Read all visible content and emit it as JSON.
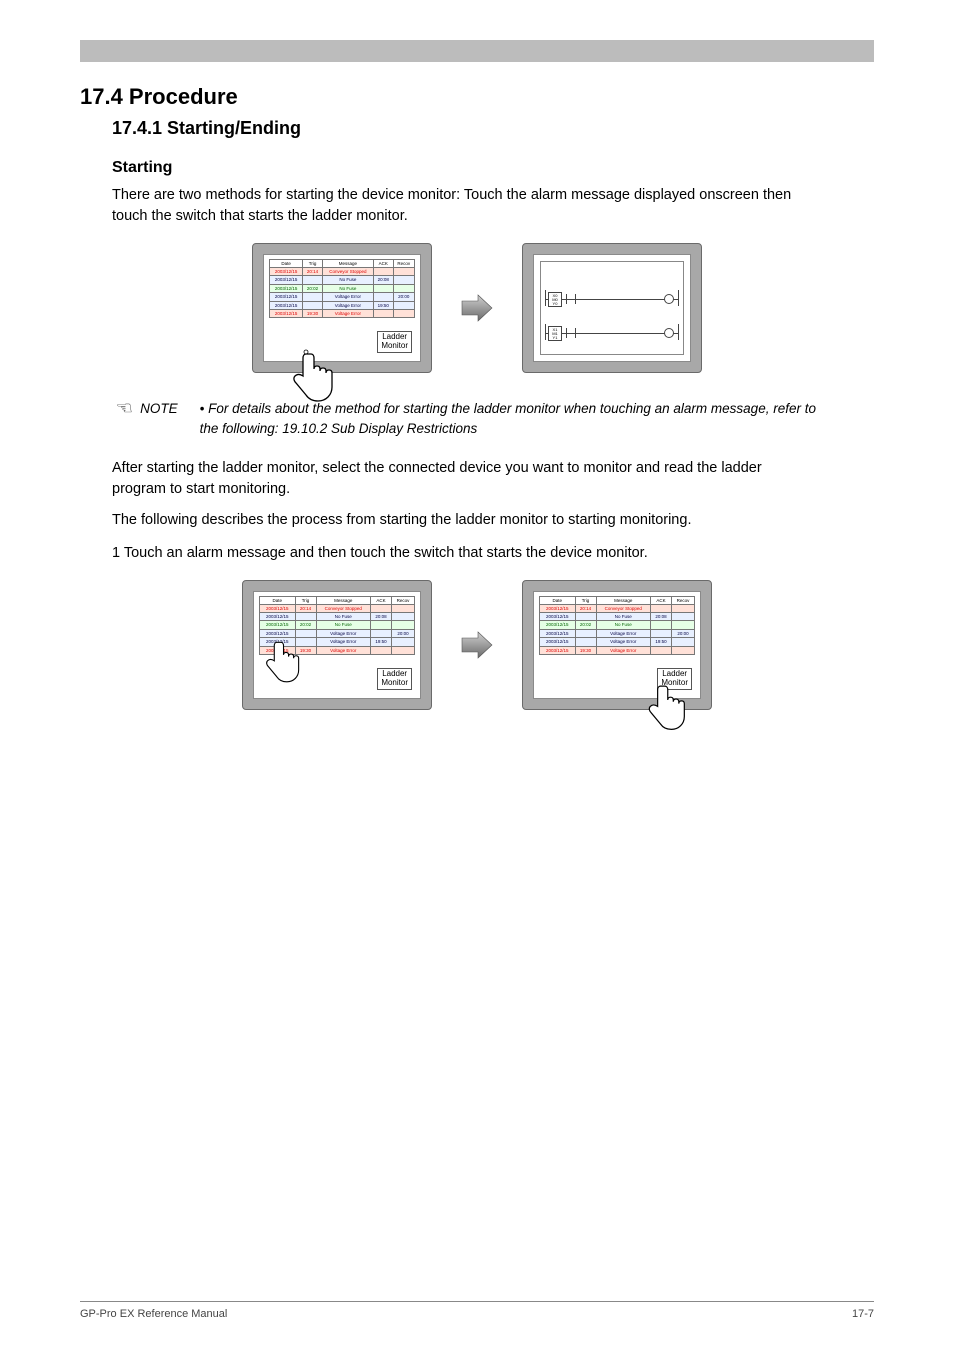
{
  "section": {
    "number": "17.4        Procedure",
    "subtitle": "17.4.1    Starting/Ending"
  },
  "intro_label": "Starting",
  "para1": "There are two methods for starting the device monitor: Touch the alarm message displayed onscreen then touch the switch that starts the ladder monitor.",
  "note_text": "For details about the method for starting the ladder monitor when touching an alarm message, refer to the following:  19.10.2 Sub Display Restrictions",
  "para2": "After starting the ladder monitor, select the connected device you want to monitor and read the ladder program to start monitoring.",
  "para3": "The following describes the process from starting the ladder monitor to starting monitoring.",
  "step1": "1  Touch an alarm message and then touch the switch that starts the device monitor.",
  "labels": {
    "ladder": "Ladder",
    "monitor": "Monitor"
  },
  "alarm_headers": [
    "Date",
    "Trig",
    "Message",
    "ACK",
    "Recov"
  ],
  "alarm_rows_screen1": [
    {
      "cls": "row-high",
      "date": "2003/12/15",
      "trig": "20:14",
      "msg": "Conveyor Stopped",
      "ack": "",
      "rec": ""
    },
    {
      "cls": "row-med",
      "date": "2003/12/15",
      "trig": "",
      "msg": "No Fuse",
      "ack": "20:08",
      "rec": ""
    },
    {
      "cls": "row-low",
      "date": "2003/12/15",
      "trig": "20:02",
      "msg": "No Fuse",
      "ack": "",
      "rec": ""
    },
    {
      "cls": "row-med",
      "date": "2003/12/15",
      "trig": "",
      "msg": "Voltage Error",
      "ack": "",
      "rec": "20:00"
    },
    {
      "cls": "row-med",
      "date": "2003/12/15",
      "trig": "",
      "msg": "Voltage Error",
      "ack": "19:50",
      "rec": ""
    },
    {
      "cls": "row-high",
      "date": "2003/12/15",
      "trig": "19:30",
      "msg": "Voltage Error",
      "ack": "",
      "rec": ""
    }
  ],
  "alarm_rows_screenA": [
    {
      "cls": "row-high",
      "date": "2003/12/15",
      "trig": "20:14",
      "msg": "Conveyor Stopped",
      "ack": "",
      "rec": ""
    },
    {
      "cls": "row-med",
      "date": "2003/12/15",
      "trig": "",
      "msg": "No Fuse",
      "ack": "20:08",
      "rec": ""
    },
    {
      "cls": "row-low",
      "date": "2003/12/15",
      "trig": "20:02",
      "msg": "No Fuse",
      "ack": "",
      "rec": ""
    },
    {
      "cls": "row-med",
      "date": "2003/12/15",
      "trig": "",
      "msg": "Voltage Error",
      "ack": "",
      "rec": "20:00"
    },
    {
      "cls": "row-med",
      "date": "2003/12/15",
      "trig": "",
      "msg": "Voltage Error",
      "ack": "19:50",
      "rec": ""
    },
    {
      "cls": "row-high",
      "date": "2003/12/15",
      "trig": "19:30",
      "msg": "Voltage Error",
      "ack": "",
      "rec": ""
    }
  ],
  "alarm_rows_screenB": [
    {
      "cls": "row-high",
      "date": "2003/12/15",
      "trig": "20:14",
      "msg": "Conveyor Stopped",
      "ack": "",
      "rec": ""
    },
    {
      "cls": "row-med",
      "date": "2003/12/15",
      "trig": "",
      "msg": "No Fuse",
      "ack": "20:08",
      "rec": ""
    },
    {
      "cls": "row-low",
      "date": "2003/12/15",
      "trig": "20:02",
      "msg": "No Fuse",
      "ack": "",
      "rec": ""
    },
    {
      "cls": "row-med",
      "date": "2003/12/15",
      "trig": "",
      "msg": "Voltage Error",
      "ack": "",
      "rec": "20:00"
    },
    {
      "cls": "row-med",
      "date": "2003/12/15",
      "trig": "",
      "msg": "Voltage Error",
      "ack": "19:50",
      "rec": ""
    },
    {
      "cls": "row-high",
      "date": "2003/12/15",
      "trig": "19:30",
      "msg": "Voltage Error",
      "ack": "",
      "rec": ""
    }
  ],
  "footer_left": "GP-Pro EX Reference Manual",
  "footer_right": "17-7"
}
